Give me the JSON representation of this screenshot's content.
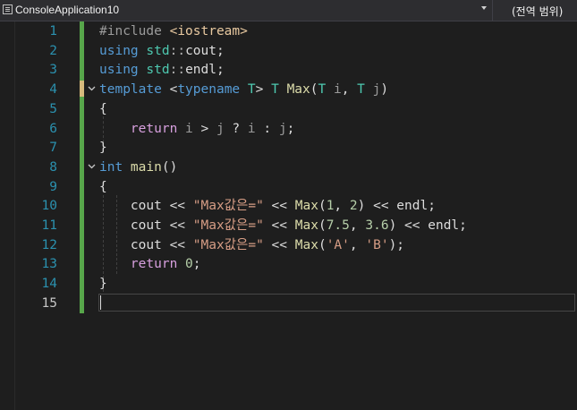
{
  "navbar": {
    "project_name": "ConsoleApplication10",
    "scope_label": "(전역 범위)"
  },
  "editor": {
    "line_numbers": [
      "1",
      "2",
      "3",
      "4",
      "5",
      "6",
      "7",
      "8",
      "9",
      "10",
      "11",
      "12",
      "13",
      "14",
      "15"
    ],
    "active_line": "15",
    "lines": [
      [
        "#include ",
        "<iostream>"
      ],
      [
        "using ",
        "std",
        "::",
        "cout",
        ";"
      ],
      [
        "using ",
        "std",
        "::",
        "endl",
        ";"
      ],
      [
        "template ",
        "<",
        "typename ",
        "T",
        "> ",
        "T ",
        "Max",
        "(",
        "T ",
        "i",
        ", ",
        "T ",
        "j",
        ")"
      ],
      [
        "{"
      ],
      [
        "    ",
        "return ",
        "i",
        " > ",
        "j",
        " ? ",
        "i",
        " : ",
        "j",
        ";"
      ],
      [
        "}"
      ],
      [
        "int ",
        "main",
        "()"
      ],
      [
        "{"
      ],
      [
        "    ",
        "cout",
        " << ",
        "\"Max값은=\"",
        " << ",
        "Max",
        "(",
        "1",
        ", ",
        "2",
        ") ",
        "<< ",
        "endl",
        ";"
      ],
      [
        "    ",
        "cout",
        " << ",
        "\"Max값은=\"",
        " << ",
        "Max",
        "(",
        "7.5",
        ", ",
        "3.6",
        ") ",
        "<< ",
        "endl",
        ";"
      ],
      [
        "    ",
        "cout",
        " << ",
        "\"Max값은=\"",
        " << ",
        "Max",
        "(",
        "'A'",
        ", ",
        "'B'",
        ");"
      ],
      [
        "    ",
        "return ",
        "0",
        ";"
      ],
      [
        "}"
      ],
      [
        ""
      ]
    ]
  },
  "colors": {
    "background": "#1e1e1e",
    "line_number": "#2b91af",
    "keyword": "#569cd6",
    "control_keyword": "#d8a0df",
    "string": "#d69d85",
    "number": "#b5cea8",
    "function": "#dcdcaa",
    "type_param": "#4ec9b0",
    "change_bar": "#57a64a"
  },
  "icons": {
    "project": "project-icon",
    "dropdown": "chevron-down-icon",
    "fold": "fold-chevron-icon"
  }
}
